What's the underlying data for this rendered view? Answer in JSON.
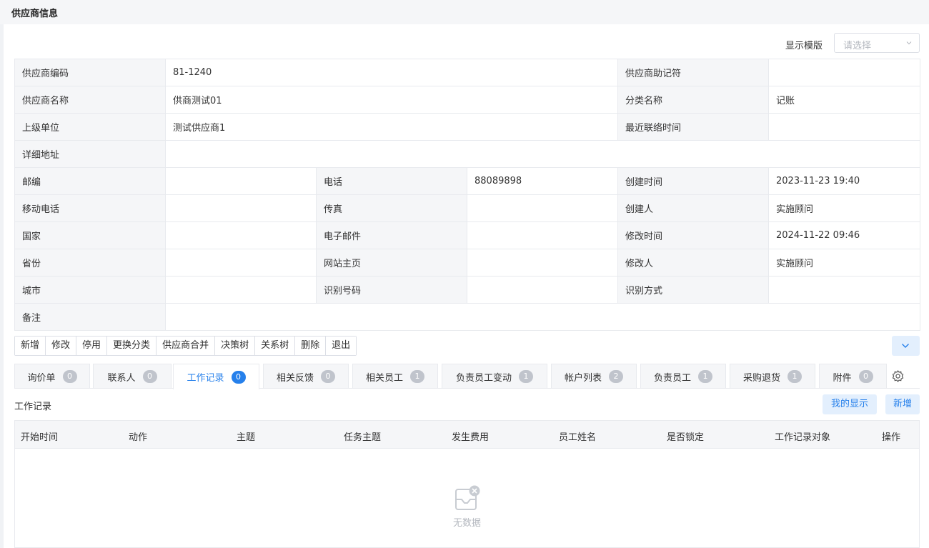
{
  "page": {
    "title": "供应商信息"
  },
  "template": {
    "label": "显示模版",
    "placeholder": "请选择"
  },
  "info": {
    "supplier_code_label": "供应商编码",
    "supplier_code": "81-1240",
    "mnemonic_label": "供应商助记符",
    "mnemonic": "",
    "supplier_name_label": "供应商名称",
    "supplier_name": "供商测试01",
    "category_label": "分类名称",
    "category": "记账",
    "parent_label": "上级单位",
    "parent": "测试供应商1",
    "last_contact_label": "最近联络时间",
    "last_contact": "",
    "address_label": "详细地址",
    "address": "",
    "zip_label": "邮编",
    "zip": "",
    "phone_label": "电话",
    "phone": "88089898",
    "created_label": "创建时间",
    "created": "2023-11-23 19:40",
    "mobile_label": "移动电话",
    "mobile": "",
    "fax_label": "传真",
    "fax": "",
    "creator_label": "创建人",
    "creator": "实施顾问",
    "country_label": "国家",
    "country": "",
    "email_label": "电子邮件",
    "email": "",
    "modified_label": "修改时间",
    "modified": "2024-11-22 09:46",
    "province_label": "省份",
    "province": "",
    "website_label": "网站主页",
    "website": "",
    "modifier_label": "修改人",
    "modifier": "实施顾问",
    "city_label": "城市",
    "city": "",
    "id_number_label": "识别号码",
    "id_number": "",
    "id_method_label": "识别方式",
    "id_method": "",
    "remark_label": "备注",
    "remark": ""
  },
  "toolbar": {
    "buttons": [
      "新增",
      "修改",
      "停用",
      "更换分类",
      "供应商合并",
      "决策树",
      "关系树",
      "删除",
      "退出"
    ]
  },
  "tabs": [
    {
      "label": "询价单",
      "count": "0"
    },
    {
      "label": "联系人",
      "count": "0"
    },
    {
      "label": "工作记录",
      "count": "0"
    },
    {
      "label": "相关反馈",
      "count": "0"
    },
    {
      "label": "相关员工",
      "count": "1"
    },
    {
      "label": "负责员工变动",
      "count": "1"
    },
    {
      "label": "帐户列表",
      "count": "2"
    },
    {
      "label": "负责员工",
      "count": "1"
    },
    {
      "label": "采购退货",
      "count": "1"
    },
    {
      "label": "附件",
      "count": "0"
    }
  ],
  "worklog": {
    "title": "工作记录",
    "my_display": "我的显示",
    "add": "新增",
    "columns": [
      "开始时间",
      "动作",
      "主题",
      "任务主题",
      "发生费用",
      "员工姓名",
      "是否锁定",
      "工作记录对象",
      "操作"
    ],
    "empty_text": "无数据"
  },
  "colors": {
    "accent": "#2680eb",
    "accent_light": "#e3effd",
    "label_bg": "#f5f6f8"
  }
}
